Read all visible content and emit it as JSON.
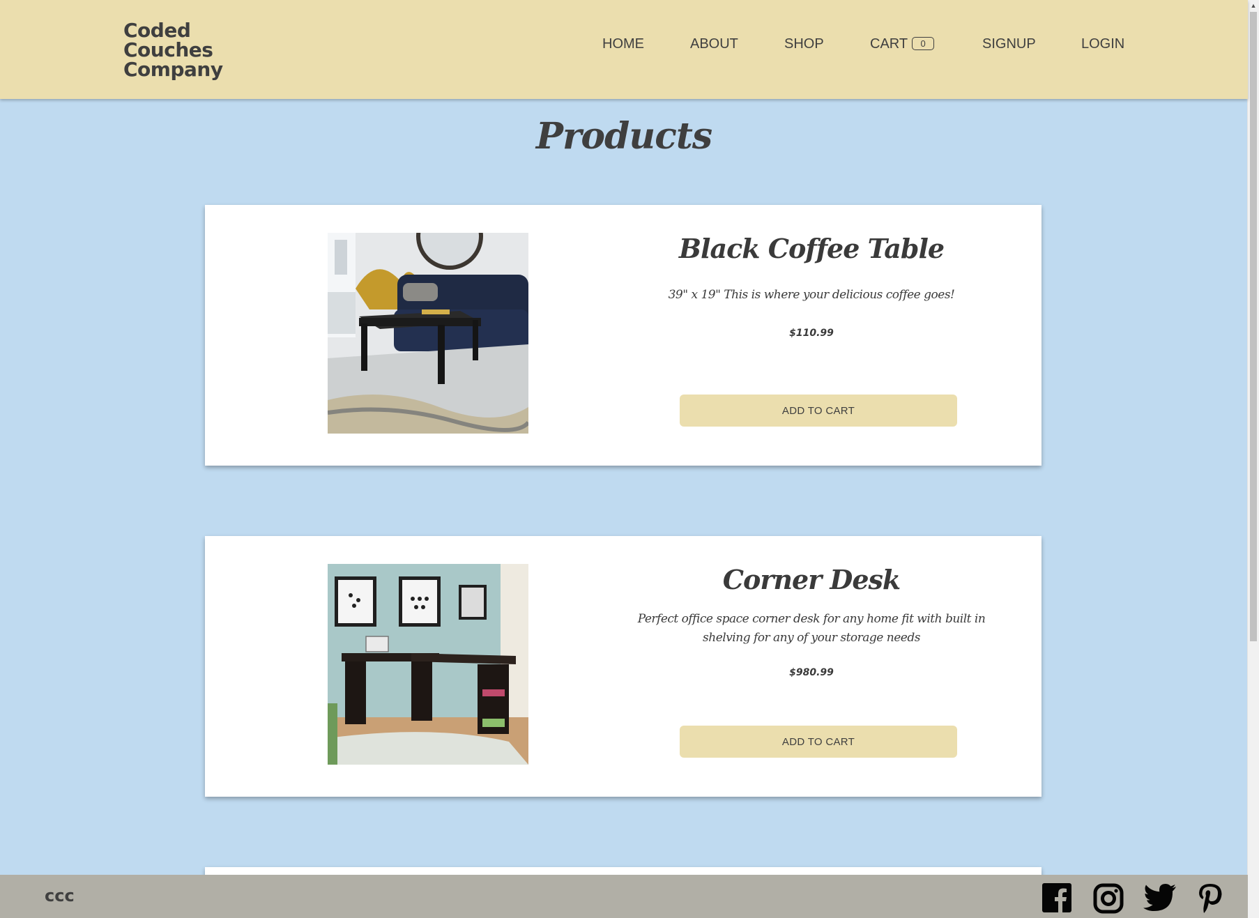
{
  "brand": {
    "logo_lines": [
      "Coded",
      "Couches",
      "Company"
    ]
  },
  "nav": {
    "home": "HOME",
    "about": "ABOUT",
    "shop": "SHOP",
    "cart": "CART",
    "cart_count": "0",
    "signup": "SIGNUP",
    "login": "LOGIN"
  },
  "page": {
    "title": "Products"
  },
  "products": [
    {
      "name": "Black Coffee Table",
      "description": "39\" x 19\" This is where your delicious coffee goes!",
      "price": "$110.99",
      "button": "ADD TO CART",
      "image_icon": "coffee-table-photo"
    },
    {
      "name": "Corner Desk",
      "description": "Perfect office space corner desk for any home fit with built in shelving for any of your storage needs",
      "price": "$980.99",
      "button": "ADD TO CART",
      "image_icon": "corner-desk-photo"
    }
  ],
  "footer": {
    "text": "ccc",
    "social_icons": [
      "facebook-icon",
      "instagram-icon",
      "twitter-icon",
      "pinterest-icon"
    ]
  },
  "colors": {
    "header_bg": "#ebdeae",
    "page_bg": "#bfdaf0",
    "footer_bg": "#b1afa6",
    "button_bg": "#ebdeae",
    "text": "#3f3f3f"
  }
}
